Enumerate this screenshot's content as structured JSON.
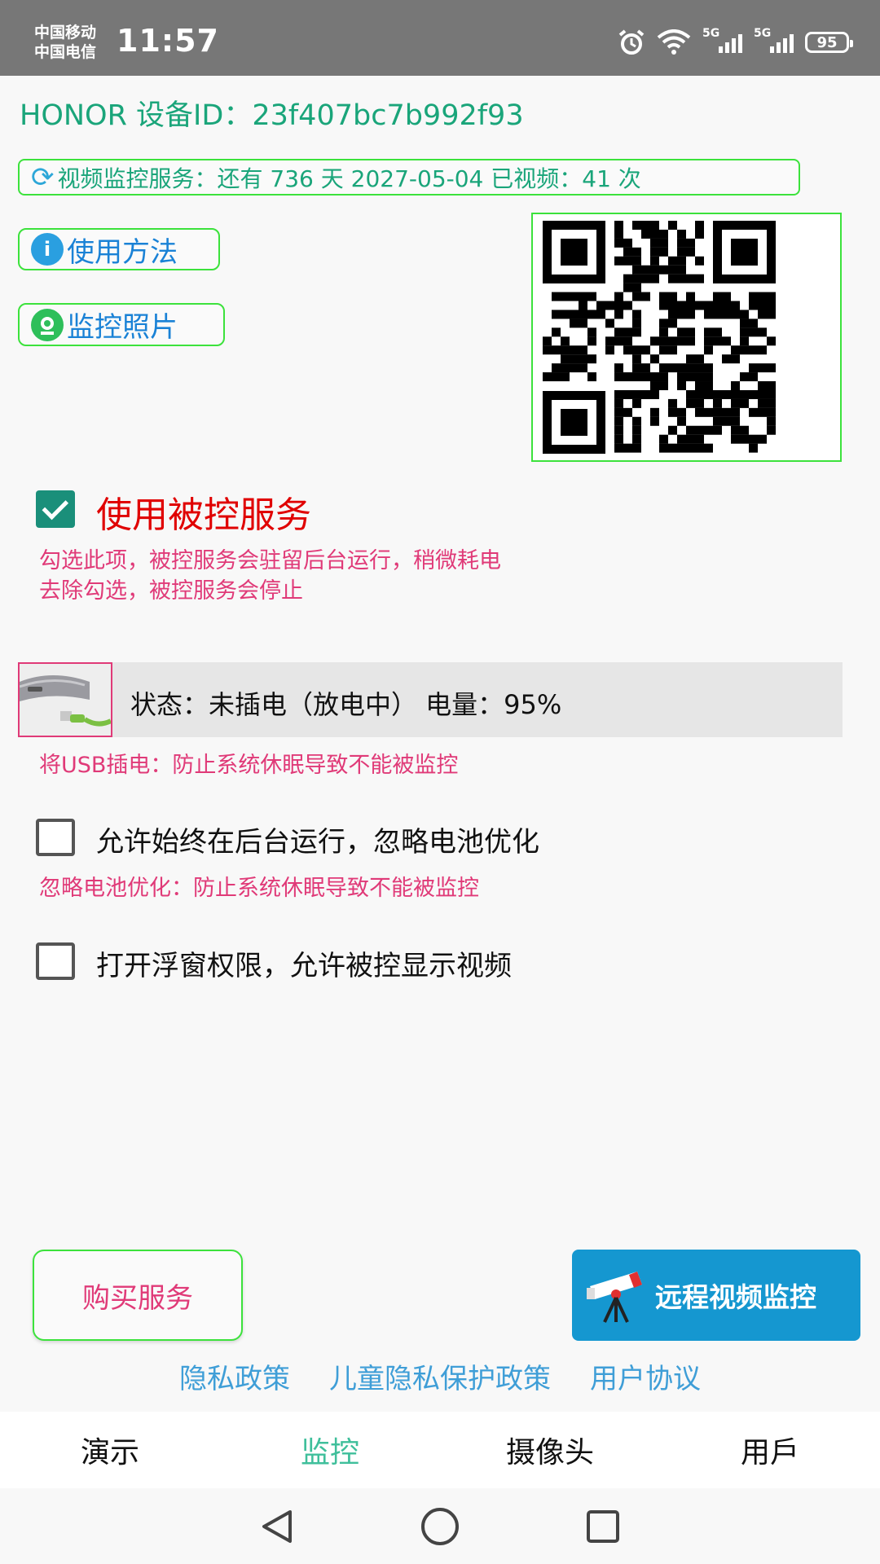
{
  "status_bar": {
    "carrier1": "中国移动",
    "carrier2": "中国电信",
    "time": "11:57",
    "net1": "5G",
    "net2": "5G",
    "battery": "95"
  },
  "device": {
    "id_label": "HONOR 设备ID：",
    "id_value": "23f407bc7b992f93"
  },
  "service_bar": {
    "text": "视频监控服务：还有 736 天 2027-05-04 已视频：41 次"
  },
  "buttons": {
    "usage": "使用方法",
    "photos": "监控照片",
    "buy": "购买服务",
    "remote": "远程视频监控"
  },
  "controlled_service": {
    "label": "使用被控服务",
    "checked": true,
    "note1": "勾选此项，被控服务会驻留后台运行，稍微耗电",
    "note2": "去除勾选，被控服务会停止"
  },
  "charging": {
    "status": "状态：未插电（放电中） 电量：95%",
    "note": "将USB插电：防止系统休眠导致不能被监控"
  },
  "background_run": {
    "label": "允许始终在后台运行，忽略电池优化",
    "checked": false,
    "note": "忽略电池优化：防止系统休眠导致不能被监控"
  },
  "float_window": {
    "label": "打开浮窗权限，允许被控显示视频",
    "checked": false
  },
  "links": {
    "privacy": "隐私政策",
    "child_privacy": "儿童隐私保护政策",
    "agreement": "用户协议"
  },
  "tabs": [
    {
      "label": "演示",
      "active": false
    },
    {
      "label": "监控",
      "active": true
    },
    {
      "label": "摄像头",
      "active": false
    },
    {
      "label": "用戶",
      "active": false
    }
  ],
  "colors": {
    "accent_green": "#1aa57a",
    "border_green": "#3ce23c",
    "alert_red": "#e00000",
    "note_pink": "#e03a78",
    "link_blue": "#3f9ed7",
    "remote_blue": "#1597d0",
    "tab_active": "#3fbf9b"
  },
  "icons": {
    "service": "refresh-icon",
    "usage": "info-icon",
    "photos": "webcam-icon",
    "remote": "telescope-icon"
  }
}
